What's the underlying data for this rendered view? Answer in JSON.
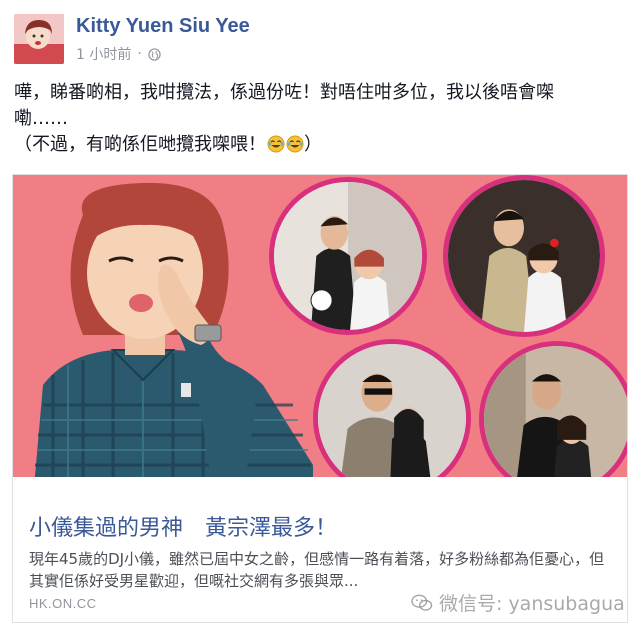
{
  "post": {
    "author": "Kitty Yuen Siu Yee",
    "time": "1 小时前",
    "dot": "·",
    "text_line1": "嘩，睇番啲相，我咁攬法，係過份咗！對唔住咁多位，我以後唔會㗎",
    "text_line2": "嘞……",
    "text_line3": "（不過，有啲係佢哋攬我㗎喂！",
    "text_line3_end": "）",
    "icons": {
      "globe": "globe-icon",
      "emoji": "laughing-tears-emoji"
    }
  },
  "link": {
    "headline_part1": "小儀集過的男神",
    "headline_part2": "黃宗澤最多！",
    "summary": "現年45歲的DJ小儀，雖然已屆中女之齡，但感情一路有着落，好多粉絲都為佢憂心，但其實佢係好受男星歡迎，但嘅社交網有多張與眾...",
    "domain": "HK.ON.CC"
  },
  "watermark": {
    "text": "微信号: yansubagua",
    "icon": "wechat-icon"
  },
  "colors": {
    "author": "#3b5998",
    "image_background": "#f07e84",
    "circle_border": "#d8307d",
    "meta": "#90949c"
  }
}
